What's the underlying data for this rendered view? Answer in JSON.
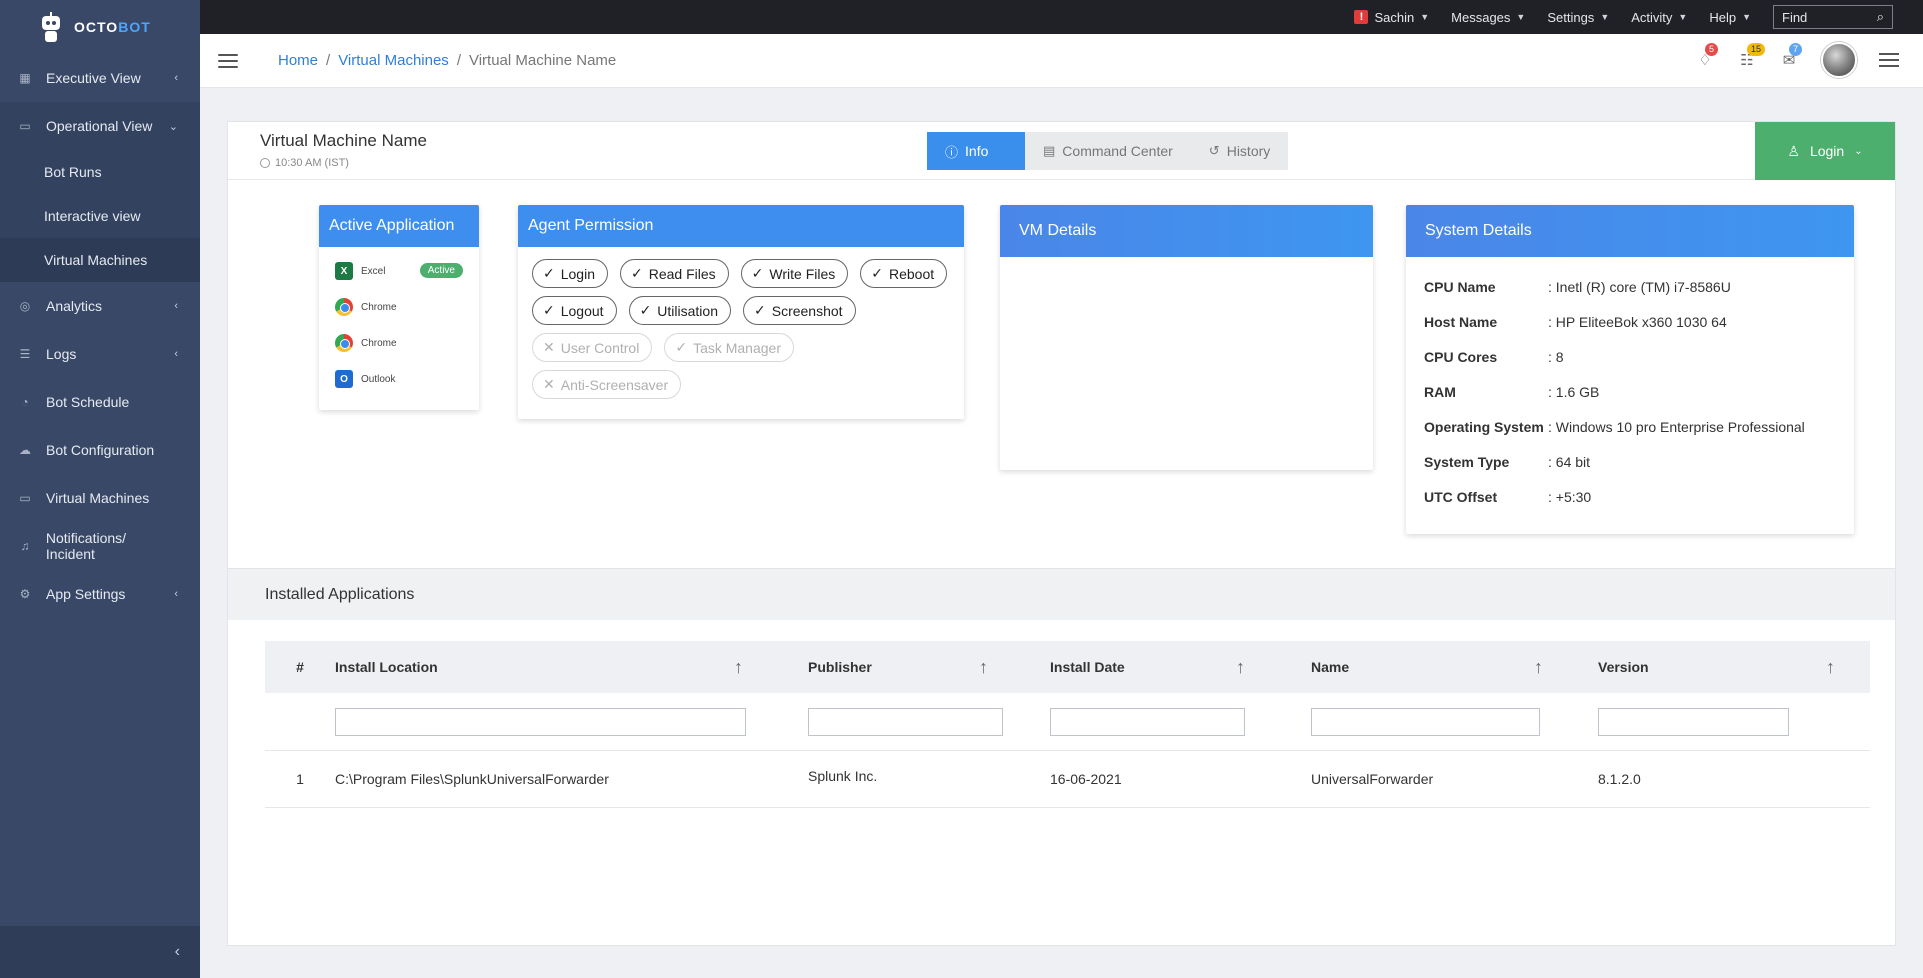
{
  "brand": {
    "prefix": "OCTO",
    "suffix": "BOT"
  },
  "sidebar": {
    "items": [
      {
        "label": "Executive View",
        "icon": "grid-icon",
        "chevron": "‹"
      },
      {
        "label": "Operational View",
        "icon": "window-icon",
        "chevron": "⌄"
      },
      {
        "label": "Analytics",
        "icon": "analytics-icon",
        "chevron": "‹"
      },
      {
        "label": "Logs",
        "icon": "logs-icon",
        "chevron": "‹"
      },
      {
        "label": "Bot Schedule",
        "icon": "schedule-icon",
        "chevron": ""
      },
      {
        "label": "Bot Configuration",
        "icon": "cloud-config-icon",
        "chevron": ""
      },
      {
        "label": "Virtual Machines",
        "icon": "monitor-icon",
        "chevron": ""
      },
      {
        "label": "Notifications/ Incident",
        "icon": "bell-icon",
        "chevron": ""
      },
      {
        "label": "App Settings",
        "icon": "gear-icon",
        "chevron": "‹"
      }
    ],
    "subitems": [
      "Bot Runs",
      "Interactive view",
      "Virtual Machines"
    ],
    "collapse": "‹"
  },
  "topbar": {
    "user": "Sachin",
    "warning": "!",
    "messages": "Messages",
    "settings": "Settings",
    "activity": "Activity",
    "help": "Help",
    "find_placeholder": "Find"
  },
  "header": {
    "breadcrumb": [
      "Home",
      "/",
      "Virtual Machines",
      "/",
      "Virtual Machine Name"
    ],
    "badges": {
      "alerts": "5",
      "tasks": "15",
      "mail": "7"
    }
  },
  "vm": {
    "title": "Virtual Machine Name",
    "time": "10:30 AM (IST)",
    "tabs": [
      "Info",
      "Command Center",
      "History"
    ],
    "login": "Login"
  },
  "active_application": {
    "title": "Active Application",
    "apps": [
      "Excel",
      "Chrome",
      "Chrome",
      "Outlook"
    ],
    "status": "Active"
  },
  "agent_permission": {
    "title": "Agent Permission",
    "enabled": [
      "Login",
      "Read Files",
      "Write Files",
      "Reboot",
      "Logout",
      "Utilisation",
      "Screenshot"
    ],
    "disabled": [
      "User Control",
      "Task Manager",
      "Anti-Screensaver"
    ]
  },
  "vm_details": {
    "title": "VM Details"
  },
  "system_details": {
    "title": "System Details",
    "rows": [
      {
        "k": "CPU Name",
        "v": ": Inetl (R) core (TM) i7-8586U"
      },
      {
        "k": "Host Name",
        "v": ": HP EliteeBok x360 1030 64"
      },
      {
        "k": "CPU Cores",
        "v": ": 8"
      },
      {
        "k": "RAM",
        "v": ": 1.6 GB"
      },
      {
        "k": "Operating System",
        "v": ": Windows 10 pro Enterprise Professional"
      },
      {
        "k": "System Type",
        "v": ": 64 bit"
      },
      {
        "k": "UTC Offset",
        "v": ": +5:30"
      }
    ]
  },
  "installed": {
    "title": "Installed Applications",
    "columns": [
      "#",
      "Install Location",
      "Publisher",
      "Install Date",
      "Name",
      "Version"
    ],
    "sort_glyph": "↑",
    "rows": [
      {
        "num": "1",
        "location": "C:\\Program Files\\SplunkUniversalForwarder",
        "publisher": "Splunk Inc.",
        "date": "16-06-2021",
        "name": "UniversalForwarder",
        "version": "8.1.2.0"
      }
    ]
  },
  "colors": {
    "sidebar": "#394866",
    "accent": "#3b8fec",
    "login": "#4caf6d",
    "topbar": "#1f2126"
  }
}
